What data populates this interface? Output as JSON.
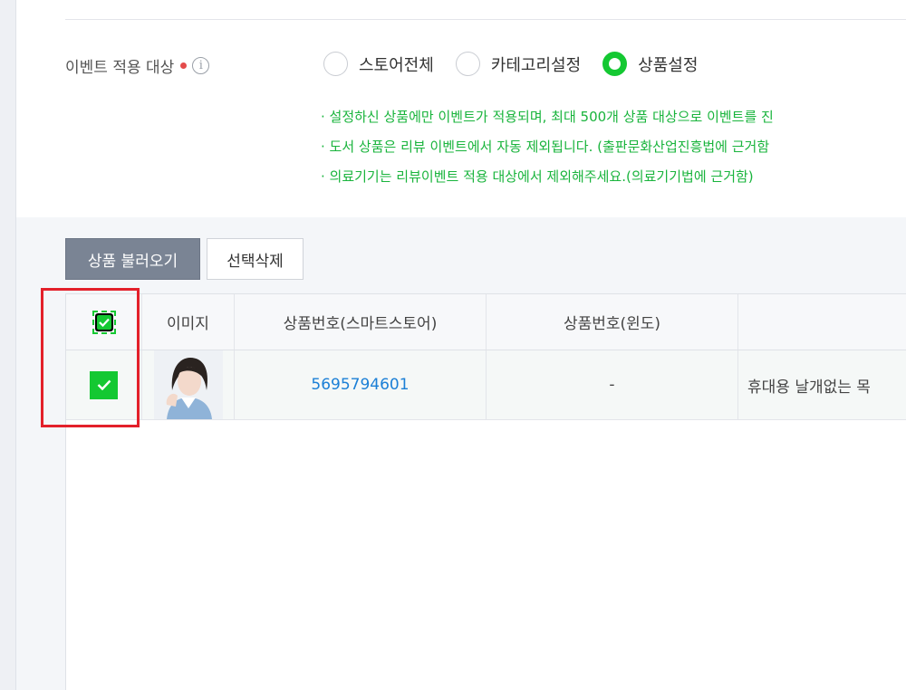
{
  "event_target": {
    "label": "이벤트 적용 대상",
    "info_icon": "i",
    "options": [
      "스토어전체",
      "카테고리설정",
      "상품설정"
    ],
    "selected": "상품설정"
  },
  "notes": [
    "· 설정하신 상품에만 이벤트가 적용되며, 최대 500개 상품 대상으로 이벤트를 진",
    "· 도서 상품은 리뷰 이벤트에서 자동 제외됩니다. (출판문화산업진흥법에 근거함",
    "· 의료기기는 리뷰이벤트 적용 대상에서 제외해주세요.(의료기기법에 근거함)"
  ],
  "buttons": {
    "load_products": "상품 불러오기",
    "delete_selected": "선택삭제"
  },
  "table": {
    "headers": {
      "image": "이미지",
      "store_product_no": "상품번호(스마트스토어)",
      "window_product_no": "상품번호(윈도)"
    },
    "rows": [
      {
        "checked": true,
        "store_product_no": "5695794601",
        "window_product_no": "-",
        "product_name": "휴대용 날개없는 목"
      }
    ]
  },
  "colors": {
    "accent_green": "#14c832",
    "note_green": "#19b43c",
    "link_blue": "#1b7fd6",
    "highlight_red": "#e3202a"
  }
}
